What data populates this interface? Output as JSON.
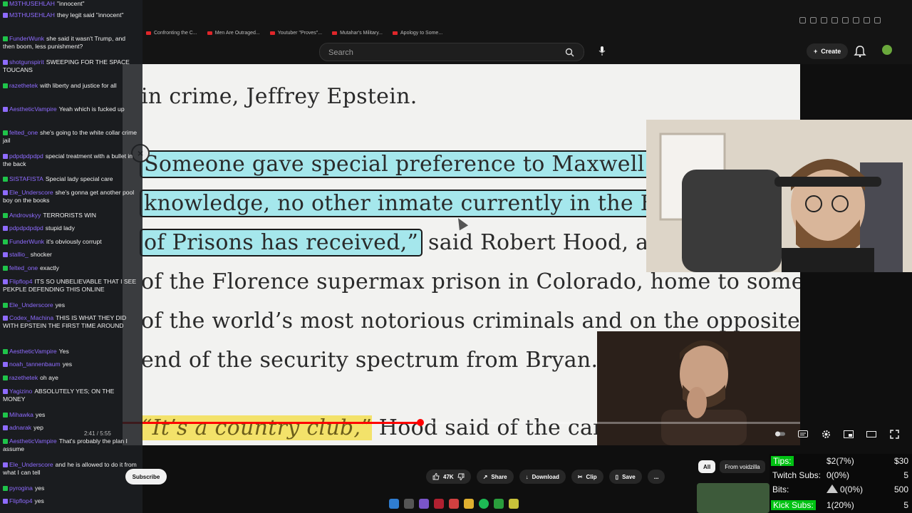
{
  "browser": {
    "bookmarks": [
      "Confronting the C...",
      "Men Are Outraged...",
      "Youtuber \"Proves\"...",
      "Mutahar's Military...",
      "Apology to Some..."
    ]
  },
  "youtube": {
    "search_placeholder": "Search",
    "create_label": "Create",
    "subscribe_label": "Subscribe",
    "likes": "47K",
    "share_label": "Share",
    "download_label": "Download",
    "clip_label": "Clip",
    "save_label": "Save",
    "more_label": "...",
    "chip_all": "All",
    "chip_from": "From voidzilla",
    "time": "2:41 / 5:55",
    "progress_fraction": 0.44
  },
  "article": {
    "line1": "in crime, Jeffrey Epstein.",
    "line2": "Someone gave special preference to Maxwell t",
    "line3": "knowledge, no other inmate currently in the Fe",
    "line4_hl": "of Prisons has received,”",
    "line4_rest": " said Robert Hood, a fo",
    "line5": "of the Florence supermax prison in Colorado, home to some",
    "line6": "of the world’s most notorious criminals and on the opposite",
    "line7": "end of the security spectrum from Bryan.",
    "line8_hl": "“It’s a country club,”",
    "line8_rest": " Hood said of the cam"
  },
  "chat": [
    {
      "user": "M3THUSEHLAH",
      "text": "\"innocent\"",
      "color": "#8e6bff"
    },
    {
      "user": "M3THUSEHLAH",
      "text": "they legit said \"innocent\"",
      "color": "#8e6bff"
    },
    {
      "user": "FunderWunk",
      "text": "she said it wasn't Trump, and then boom, less punishment?",
      "color": "#8e6bff"
    },
    {
      "user": "shotgunspirit",
      "text": "SWEEPING FOR THE SPACE TOUCANS",
      "color": "#8e6bff"
    },
    {
      "user": "razethetek",
      "text": "with liberty and justice for all",
      "color": "#8e6bff"
    },
    {
      "user": "AestheticVampire",
      "text": "Yeah which is fucked up",
      "color": "#8e6bff"
    },
    {
      "user": "felted_one",
      "text": "she's going to the white collar crime jail",
      "color": "#8e6bff"
    },
    {
      "user": "pdpdpdpdpd",
      "text": "special treatment with a bullet in the back",
      "color": "#8e6bff"
    },
    {
      "user": "SISTAFISTA",
      "text": "Special lady special care",
      "color": "#8e6bff"
    },
    {
      "user": "Ele_Underscore",
      "text": "she's gonna get another pool boy on the books",
      "color": "#8e6bff"
    },
    {
      "user": "Androvskyy",
      "text": "TERRORISTS WIN",
      "color": "#8e6bff"
    },
    {
      "user": "pdpdpdpdpd",
      "text": "stupid lady",
      "color": "#8e6bff"
    },
    {
      "user": "FunderWunk",
      "text": "it's obviously corrupt",
      "color": "#8e6bff"
    },
    {
      "user": "stallio_",
      "text": "shocker",
      "color": "#8e6bff"
    },
    {
      "user": "felted_one",
      "text": "exactly",
      "color": "#8e6bff"
    },
    {
      "user": "Flipflop4",
      "text": "ITS SO UNBELIEVABLE THAT I SEE PEKPLE DEFENDING THIS ONLINE",
      "color": "#8e6bff"
    },
    {
      "user": "Ele_Underscore",
      "text": "yes",
      "color": "#8e6bff"
    },
    {
      "user": "Codex_Machina",
      "text": "THIS IS WHAT THEY DID WITH EPSTEIN THE FIRST TIME AROUND",
      "color": "#8e6bff"
    },
    {
      "user": "AestheticVampire",
      "text": "Yes",
      "color": "#8e6bff"
    },
    {
      "user": "noah_tannenbaum",
      "text": "yes",
      "color": "#8e6bff"
    },
    {
      "user": "razethetek",
      "text": "oh aye",
      "color": "#8e6bff"
    },
    {
      "user": "Yagizino",
      "text": "ABSOLUTELY YES; ON THE MONEY",
      "color": "#8e6bff"
    },
    {
      "user": "Mihawka",
      "text": "yes",
      "color": "#8e6bff"
    },
    {
      "user": "adnarak",
      "text": "yep",
      "color": "#8e6bff"
    },
    {
      "user": "AestheticVampire",
      "text": "That's probably the plan I assume",
      "color": "#8e6bff"
    },
    {
      "user": "Ele_Underscore",
      "text": "and he is allowed to do it from what I can tell",
      "color": "#8e6bff"
    },
    {
      "user": "pyrogina",
      "text": "yes",
      "color": "#8e6bff"
    },
    {
      "user": "Flipflop4",
      "text": "yes",
      "color": "#8e6bff"
    }
  ],
  "stats": {
    "tips_label": "Tips:",
    "tips_value": "$2(7%)",
    "tips_goal": "$30",
    "twitch_label": "Twitch Subs:",
    "twitch_value": "0(0%)",
    "twitch_goal": "5",
    "bits_label": "Bits:",
    "bits_value": "0(0%)",
    "bits_goal": "500",
    "kick_label": "Kick Subs:",
    "kick_value": "1(20%)",
    "kick_goal": "5"
  }
}
